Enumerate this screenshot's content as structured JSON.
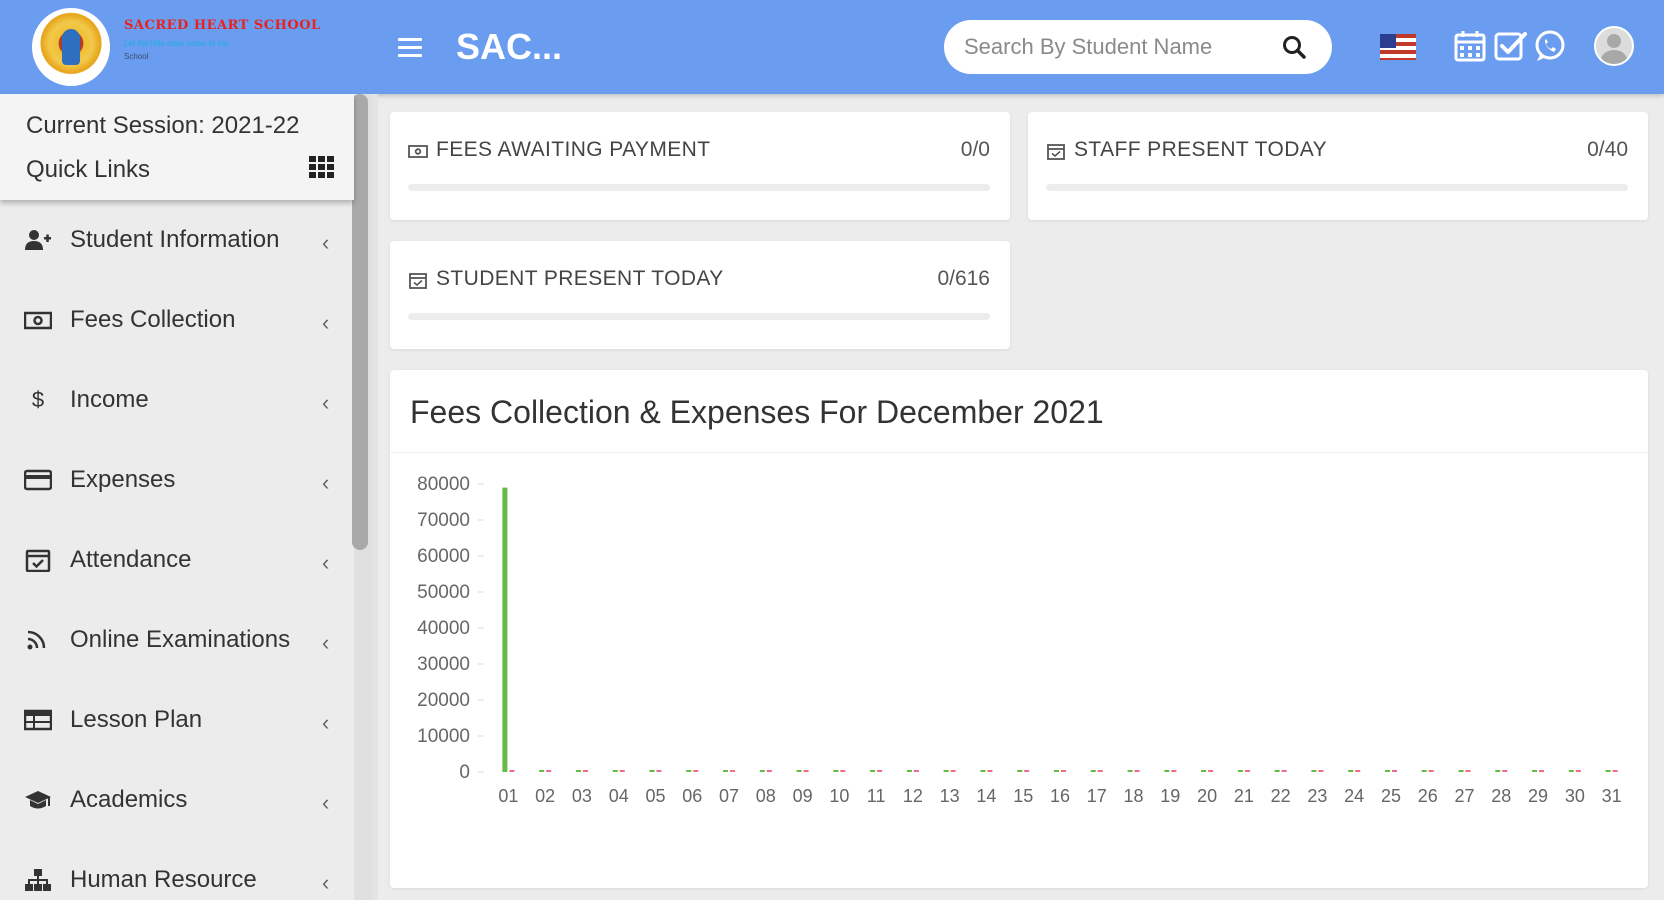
{
  "header": {
    "brand_name": "SACRED HEART SCHOOL",
    "brand_tagline": "Let the little ones come to me",
    "brand_sub": "School",
    "app_title": "SAC...",
    "search_placeholder": "Search By Student Name",
    "colors": {
      "bar": "#6a9cf0"
    },
    "icons": [
      "calendar-icon",
      "check-square-icon",
      "whatsapp-icon"
    ]
  },
  "sidebar": {
    "session": "Current Session: 2021-22",
    "quick_links": "Quick Links",
    "items": [
      {
        "label": "Student Information",
        "icon": "user-plus-icon"
      },
      {
        "label": "Fees Collection",
        "icon": "money-icon"
      },
      {
        "label": "Income",
        "icon": "dollar-icon"
      },
      {
        "label": "Expenses",
        "icon": "credit-card-icon"
      },
      {
        "label": "Attendance",
        "icon": "calendar-check-icon"
      },
      {
        "label": "Online Examinations",
        "icon": "rss-icon"
      },
      {
        "label": "Lesson Plan",
        "icon": "table-icon"
      },
      {
        "label": "Academics",
        "icon": "graduation-cap-icon"
      },
      {
        "label": "Human Resource",
        "icon": "sitemap-icon"
      }
    ]
  },
  "stats": {
    "fees": {
      "label": "FEES AWAITING PAYMENT",
      "value": "0/0"
    },
    "staff": {
      "label": "STAFF PRESENT TODAY",
      "value": "0/40"
    },
    "student": {
      "label": "STUDENT PRESENT TODAY",
      "value": "0/616"
    }
  },
  "chart": {
    "title": "Fees Collection & Expenses For December 2021"
  },
  "chart_data": {
    "type": "bar",
    "title": "Fees Collection & Expenses For December 2021",
    "categories": [
      "01",
      "02",
      "03",
      "04",
      "05",
      "06",
      "07",
      "08",
      "09",
      "10",
      "11",
      "12",
      "13",
      "14",
      "15",
      "16",
      "17",
      "18",
      "19",
      "20",
      "21",
      "22",
      "23",
      "24",
      "25",
      "26",
      "27",
      "28",
      "29",
      "30",
      "31"
    ],
    "series": [
      {
        "color": "#66bb44",
        "values": [
          79000,
          0,
          0,
          0,
          0,
          0,
          0,
          0,
          0,
          0,
          0,
          0,
          0,
          0,
          0,
          0,
          0,
          0,
          0,
          0,
          0,
          0,
          0,
          0,
          0,
          0,
          0,
          0,
          0,
          0,
          0
        ]
      },
      {
        "color": "#f06a8a",
        "values": [
          0,
          0,
          0,
          0,
          0,
          0,
          0,
          0,
          0,
          0,
          0,
          0,
          0,
          0,
          0,
          0,
          0,
          0,
          0,
          0,
          0,
          0,
          0,
          0,
          0,
          0,
          0,
          0,
          0,
          0,
          0
        ]
      }
    ],
    "yticks": [
      80000,
      70000,
      60000,
      50000,
      40000,
      30000,
      20000,
      10000,
      0
    ],
    "ylim": [
      0,
      80000
    ],
    "xlabel": "",
    "ylabel": ""
  }
}
